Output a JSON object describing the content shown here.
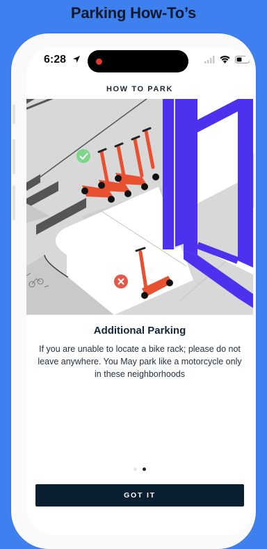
{
  "headline": "Parking How-To’s",
  "status_bar": {
    "time": "6:28"
  },
  "screen": {
    "title": "HOW TO PARK",
    "info_title": "Additional Parking",
    "info_body": "If you are unable to locate a bike rack; please do not leave anywhere. You May park like a motorcycle only in these neighborhoods",
    "primary_button_label": "GOT IT",
    "pagination": {
      "current": 2,
      "total": 2
    }
  },
  "icons": [
    "location-arrow-icon",
    "signal-icon",
    "wifi-icon",
    "battery-icon",
    "check-icon",
    "x-icon",
    "bike-rack-icon"
  ],
  "colors": {
    "background": "#3f80f0",
    "button": "#0b1f33",
    "accent_purple": "#4c31ee",
    "scooter": "#e8502f",
    "ok_green": "#7ed68b",
    "bad_red": "#e45a4a"
  }
}
